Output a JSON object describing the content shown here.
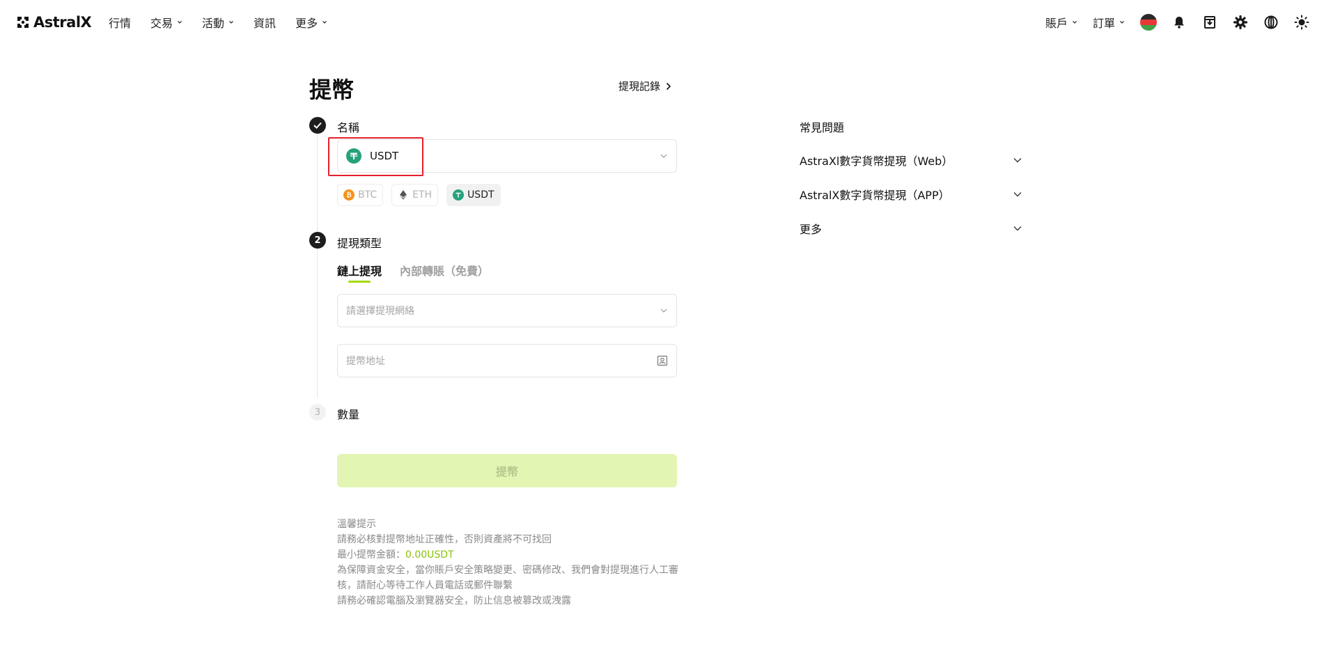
{
  "brand": {
    "name": "AstralX"
  },
  "nav": {
    "left": [
      {
        "label": "行情",
        "has_caret": false
      },
      {
        "label": "交易",
        "has_caret": true
      },
      {
        "label": "活動",
        "has_caret": true
      },
      {
        "label": "資訊",
        "has_caret": false
      },
      {
        "label": "更多",
        "has_caret": true
      }
    ],
    "right": {
      "account_label": "賬戶",
      "orders_label": "訂單",
      "icons": [
        "avatar",
        "bell-icon",
        "download-icon",
        "gear-icon",
        "globe-icon",
        "sun-icon"
      ]
    }
  },
  "page": {
    "title": "提幣",
    "history_link": "提現記錄"
  },
  "steps": {
    "step1": {
      "label": "名稱"
    },
    "step2": {
      "number": "2",
      "label": "提現類型"
    },
    "step3": {
      "number": "3",
      "label": "數量"
    }
  },
  "coin_select": {
    "selected": "USDT",
    "quick_chips": [
      {
        "symbol": "BTC",
        "selected": false
      },
      {
        "symbol": "ETH",
        "selected": false
      },
      {
        "symbol": "USDT",
        "selected": true
      }
    ]
  },
  "withdraw_tabs": [
    {
      "label": "鏈上提現",
      "active": true
    },
    {
      "label": "內部轉賬（免費）",
      "active": false
    }
  ],
  "network_field": {
    "placeholder": "請選擇提現網絡"
  },
  "address_field": {
    "placeholder": "提幣地址"
  },
  "submit": {
    "label": "提幣"
  },
  "tips": {
    "title": "溫馨提示",
    "line1": "請務必核對提幣地址正確性，否則資產將不可找回",
    "min_label": "最小提幣金額：",
    "min_value": "0.00USDT",
    "line3": "為保障資金安全，當你賬戶安全策略變更、密碼修改、我們會對提現進行人工審核，請耐心等待工作人員電話或郵件聯繫",
    "line4": "請務必確認電腦及瀏覽器安全，防止信息被篡改或洩露"
  },
  "faq": {
    "title": "常見問題",
    "items": [
      {
        "label": "AstraXl數字貨幣提現（Web）"
      },
      {
        "label": "AstralX數字貨幣提現（APP）"
      },
      {
        "label": "更多"
      }
    ]
  },
  "colors": {
    "accent": "#a3d900",
    "highlight_box": "#e5202b",
    "usdt": "#26a17b",
    "btc": "#f7931a",
    "submit_disabled_bg": "#e3f5b3"
  }
}
